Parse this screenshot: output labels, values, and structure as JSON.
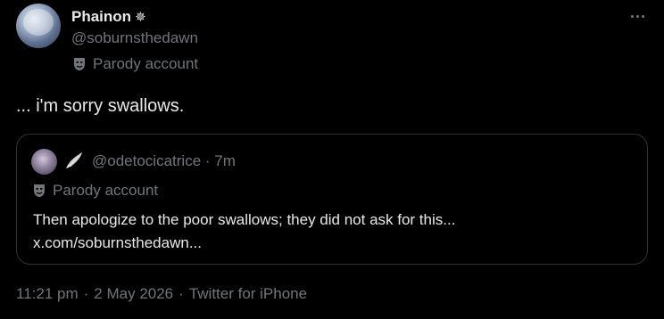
{
  "author": {
    "display_name": "Phainon",
    "name_emoji": "✵",
    "handle": "@soburnsthedawn",
    "label": "Parody account"
  },
  "tweet": {
    "text": "... i'm sorry swallows."
  },
  "quoted": {
    "emoji_icon": "wing-icon",
    "handle": "@odetocicatrice",
    "separator": "·",
    "time": "7m",
    "label": "Parody account",
    "text": "Then apologize to the poor swallows; they did not ask for this...",
    "link": "x.com/soburnsthedawn..."
  },
  "footer": {
    "time": "11:21 pm",
    "sep1": "·",
    "date": "2 May 2026",
    "sep2": "·",
    "client": "Twitter for iPhone"
  },
  "colors": {
    "background": "#000000",
    "text": "#e7e9ea",
    "secondary": "#71767b",
    "border": "#2f3336"
  }
}
